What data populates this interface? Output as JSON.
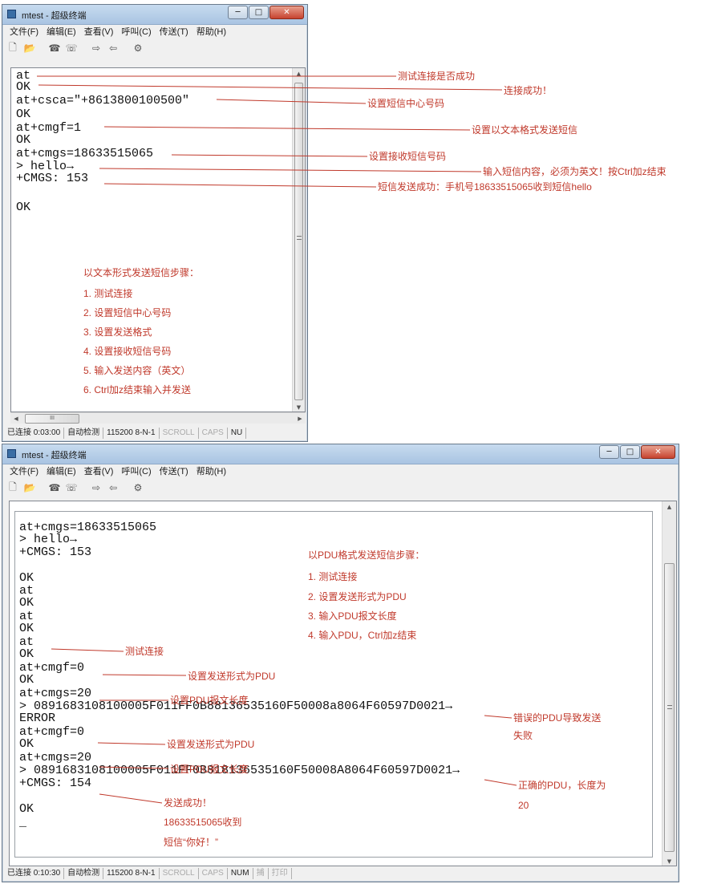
{
  "window1": {
    "title": "mtest - 超级终端",
    "menu": [
      "文件(F)",
      "编辑(E)",
      "查看(V)",
      "呼叫(C)",
      "传送(T)",
      "帮助(H)"
    ],
    "caption_buttons": {
      "minimize": "─",
      "maximize": "□",
      "close": "✕"
    },
    "terminal_lines": [
      "at",
      "OK",
      "at+csca=\"+8613800100500\"",
      "OK",
      "at+cmgf=1",
      "OK",
      "at+cmgs=18633515065",
      "> hello→",
      "+CMGS: 153",
      "",
      "OK"
    ],
    "annotations": [
      "测试连接是否成功",
      "连接成功！",
      "设置短信中心号码",
      "设置以文本格式发送短信",
      "设置接收短信号码",
      "输入短信内容，必须为英文！按Ctrl加z结束",
      "短信发送成功：手机号18633515065收到短信hello"
    ],
    "steps_title": "以文本形式发送短信步骤：",
    "steps": [
      "1. 测试连接",
      "2. 设置短信中心号码",
      "3. 设置发送格式",
      "4. 设置接收短信号码",
      "5. 输入发送内容（英文）",
      "6. Ctrl加z结束输入并发送"
    ],
    "hscroll_thumb_label": "III",
    "status": [
      "已连接 0:03:00",
      "自动检测",
      "115200 8-N-1",
      "SCROLL",
      "CAPS",
      "NU"
    ]
  },
  "window2": {
    "title": "mtest - 超级终端",
    "menu": [
      "文件(F)",
      "编辑(E)",
      "查看(V)",
      "呼叫(C)",
      "传送(T)",
      "帮助(H)"
    ],
    "caption_buttons": {
      "minimize": "─",
      "maximize": "□",
      "close": "✕"
    },
    "terminal_lines": [
      "at+cmgs=18633515065",
      "> hello→",
      "+CMGS: 153",
      "",
      "OK",
      "at",
      "OK",
      "at",
      "OK",
      "at",
      "OK",
      "at+cmgf=0",
      "OK",
      "at+cmgs=20",
      "> 0891683108100005F011FF0B88136535160F50008a8064F60597D0021→",
      "ERROR",
      "at+cmgf=0",
      "OK",
      "at+cmgs=20",
      "> 0891683108100005F011FF0B818136535160F50008A8064F60597D0021→",
      "+CMGS: 154",
      "",
      "OK",
      "_"
    ],
    "steps_title": "以PDU格式发送短信步骤：",
    "steps": [
      "1. 测试连接",
      "2. 设置发送形式为PDU",
      "3. 输入PDU报文长度",
      "4. 输入PDU，Ctrl加z结束"
    ],
    "annotations": [
      "测试连接",
      "设置发送形式为PDU",
      "设置PDU报文长度",
      "错误的PDU导致发送",
      "失败",
      "设置发送形式为PDU",
      "设置PDU报文长度",
      "正确的PDU，长度为",
      "20",
      "发送成功！",
      "18633515065收到",
      "短信“你好！”"
    ],
    "status": [
      "已连接 0:10:30",
      "自动检测",
      "115200 8-N-1",
      "SCROLL",
      "CAPS",
      "NUM",
      "捕",
      "打印"
    ]
  },
  "colors": {
    "annotation": "#c0392b",
    "terminal_text": "#111111",
    "title_bar": "#b8d0ea",
    "close_button": "#c7432f"
  }
}
